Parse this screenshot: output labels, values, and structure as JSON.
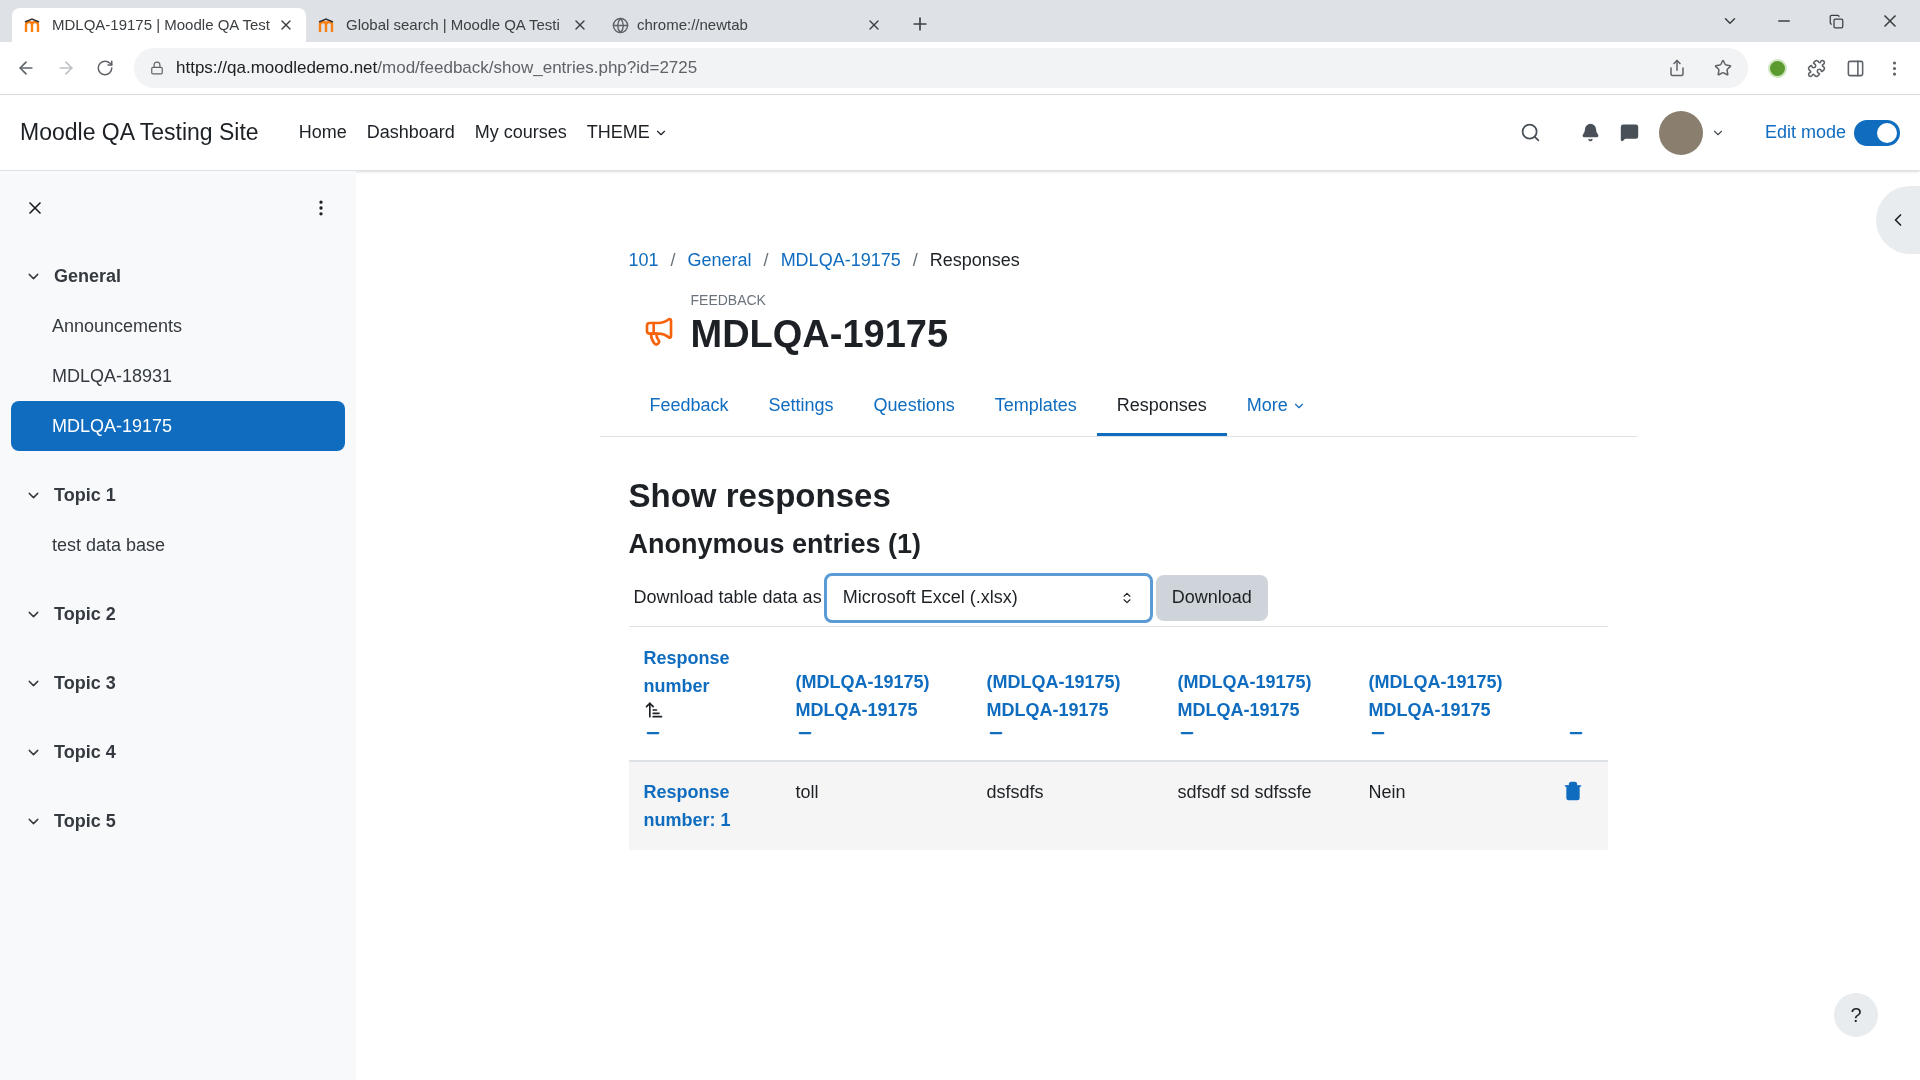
{
  "browser": {
    "tabs": [
      {
        "title": "MDLQA-19175 | Moodle QA Test",
        "kind": "moodle",
        "selected": true
      },
      {
        "title": "Global search | Moodle QA Testi",
        "kind": "moodle",
        "selected": false
      },
      {
        "title": "chrome://newtab",
        "kind": "globe",
        "selected": false
      }
    ],
    "url": {
      "host": "https://qa.moodledemo.net",
      "path": "/mod/feedback/show_entries.php?id=2725"
    }
  },
  "navbar": {
    "site_name": "Moodle QA Testing Site",
    "links": [
      {
        "label": "Home",
        "dropdown": false
      },
      {
        "label": "Dashboard",
        "dropdown": false
      },
      {
        "label": "My courses",
        "dropdown": false
      },
      {
        "label": "THEME",
        "dropdown": true
      }
    ],
    "edit_mode": {
      "label": "Edit mode",
      "on": true
    }
  },
  "sidebar": {
    "sections": [
      {
        "title": "General",
        "expanded": true,
        "items": [
          {
            "label": "Announcements",
            "selected": false
          },
          {
            "label": "MDLQA-18931",
            "selected": false
          },
          {
            "label": "MDLQA-19175",
            "selected": true
          }
        ]
      },
      {
        "title": "Topic 1",
        "expanded": true,
        "items": [
          {
            "label": "test data base",
            "selected": false
          }
        ]
      },
      {
        "title": "Topic 2",
        "expanded": true
      },
      {
        "title": "Topic 3",
        "expanded": true
      },
      {
        "title": "Topic 4",
        "expanded": true
      },
      {
        "title": "Topic 5",
        "expanded": true
      }
    ]
  },
  "breadcrumb": {
    "separator": "/",
    "items": [
      {
        "label": "101",
        "link": true
      },
      {
        "label": "General",
        "link": true
      },
      {
        "label": "MDLQA-19175",
        "link": true
      },
      {
        "label": "Responses",
        "link": false
      }
    ]
  },
  "activity": {
    "type_label": "FEEDBACK",
    "title": "MDLQA-19175"
  },
  "tabs": [
    {
      "label": "Feedback",
      "selected": false,
      "dropdown": false
    },
    {
      "label": "Settings",
      "selected": false,
      "dropdown": false
    },
    {
      "label": "Questions",
      "selected": false,
      "dropdown": false
    },
    {
      "label": "Templates",
      "selected": false,
      "dropdown": false
    },
    {
      "label": "Responses",
      "selected": true,
      "dropdown": false
    },
    {
      "label": "More",
      "selected": false,
      "dropdown": true
    }
  ],
  "heading": "Show responses",
  "subheading": "Anonymous entries (1)",
  "download": {
    "label": "Download table data as",
    "format": "Microsoft Excel (.xlsx)",
    "button": "Download"
  },
  "table": {
    "columns": [
      {
        "label": "Response number",
        "sorted": true
      },
      {
        "label": "(MDLQA-19175) MDLQA-19175",
        "sorted": false
      },
      {
        "label": "(MDLQA-19175) MDLQA-19175",
        "sorted": false
      },
      {
        "label": "(MDLQA-19175) MDLQA-19175",
        "sorted": false
      },
      {
        "label": "(MDLQA-19175) MDLQA-19175",
        "sorted": false
      },
      {
        "sorted": false
      }
    ],
    "rows": [
      {
        "cells": [
          "Response number: 1",
          "toll",
          "dsfsdfs",
          "sdfsdf sd sdfssfe",
          "Nein"
        ]
      }
    ]
  },
  "help_button": "?"
}
